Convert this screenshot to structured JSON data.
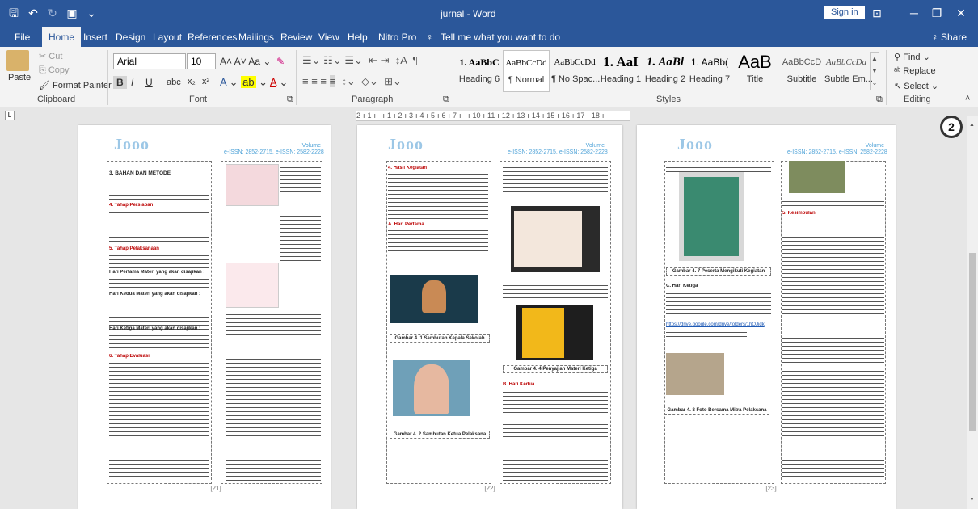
{
  "titlebar": {
    "title": "jurnal - Word",
    "sign_in": "Sign in"
  },
  "tabs": [
    "File",
    "Home",
    "Insert",
    "Design",
    "Layout",
    "References",
    "Mailings",
    "Review",
    "View",
    "Help",
    "Nitro Pro"
  ],
  "tell_me": "Tell me what you want to do",
  "share": "Share",
  "clipboard": {
    "paste": "Paste",
    "cut": "Cut",
    "copy": "Copy",
    "format_painter": "Format Painter",
    "label": "Clipboard"
  },
  "font": {
    "name": "Arial",
    "size": "10",
    "label": "Font",
    "bold": "B",
    "italic": "I",
    "underline": "U",
    "strike": "abc",
    "sub": "x₂",
    "sup": "x²"
  },
  "paragraph": {
    "label": "Paragraph"
  },
  "styles": {
    "label": "Styles",
    "items": [
      {
        "preview": "1. AaBbC",
        "name": "Heading 6"
      },
      {
        "preview": "AaBbCcDd",
        "name": "¶ Normal"
      },
      {
        "preview": "AaBbCcDd",
        "name": "¶ No Spac..."
      },
      {
        "preview": "1. AaI",
        "name": "Heading 1"
      },
      {
        "preview": "1. AaBl",
        "name": "Heading 2"
      },
      {
        "preview": "1. AaBb(",
        "name": "Heading 7"
      },
      {
        "preview": "AaB",
        "name": "Title"
      },
      {
        "preview": "AaBbCcD",
        "name": "Subtitle"
      },
      {
        "preview": "AaBbCcDa",
        "name": "Subtle Em..."
      }
    ]
  },
  "editing": {
    "find": "Find",
    "replace": "Replace",
    "select": "Select",
    "label": "Editing"
  },
  "ruler_text": "2·ı·1·ı· ·ı·1·ı·2·ı·3·ı·4·ı·5·ı·6·ı·7·ı· ·ı·10·ı·11·ı·12·ı·13·ı·14·ı·15·ı·16·ı·17·ı·18·ı",
  "badge": "2",
  "pages": [
    {
      "logo": "Jooo",
      "header": "Volume\ne-ISSN: 2852-2715, e-ISSN: 2582-2228",
      "page_number": "[21]",
      "heading1": "3. BAHAN DAN METODE",
      "heading2": "4. Tahap Persiapan",
      "heading3": "5. Tahap Pelaksanaan",
      "heading4": "Hari Pertama Materi yang akan disajikan :",
      "heading5": "Hari Kedua Materi yang akan disajikan :",
      "heading6": "Hari Ketiga Materi yang akan disajikan :",
      "heading7": "6. Tahap Evaluasi"
    },
    {
      "logo": "Jooo",
      "header": "Volume\ne-ISSN: 2852-2715, e-ISSN: 2582-2228",
      "page_number": "[22]",
      "heading1": "4. Hasil Kegiatan",
      "heading2": "A. Hari Pertama",
      "caption1": "Gambar 4. 1 Sambutan Kepala Sekolah",
      "caption2": "Gambar 4. 2 Sambutan Ketua Pelaksana",
      "caption3": "Gambar 4. 4 Penyajian Materi Ketiga",
      "heading3": "B. Hari Kedua"
    },
    {
      "logo": "Jooo",
      "header": "Volume\ne-ISSN: 2852-2715, e-ISSN: 2582-2228",
      "page_number": "[23]",
      "heading1": "5. Kesimpulan",
      "caption1": "Gambar 4. 7 Peserta Mengikuti Kegiatan",
      "heading2": "C. Hari Ketiga",
      "link": "https://drive.google.com/drive/folders/1hQJjdk",
      "caption2": "Gambar 4. 8 Foto Bersama Mitra Pelaksana"
    }
  ]
}
